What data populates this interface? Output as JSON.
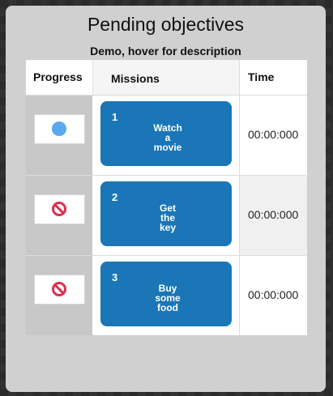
{
  "panel": {
    "title": "Pending objectives",
    "subtitle": "Demo, hover for description"
  },
  "table": {
    "headers": {
      "progress": "Progress",
      "missions": "Missions",
      "time": "Time"
    },
    "rows": [
      {
        "status_icon": "in-progress-dot-icon",
        "number": "1",
        "mission": "Watch a movie",
        "time": "00:00:000"
      },
      {
        "status_icon": "blocked-icon",
        "number": "2",
        "mission": "Get the key",
        "time": "00:00:000"
      },
      {
        "status_icon": "blocked-icon",
        "number": "3",
        "mission": "Buy some food",
        "time": "00:00:000"
      }
    ]
  },
  "colors": {
    "mission_button": "#1a76b7",
    "in_progress_dot": "#5aa9ee",
    "blocked": "#d9304f",
    "panel_bg": "#d0d0d0"
  }
}
